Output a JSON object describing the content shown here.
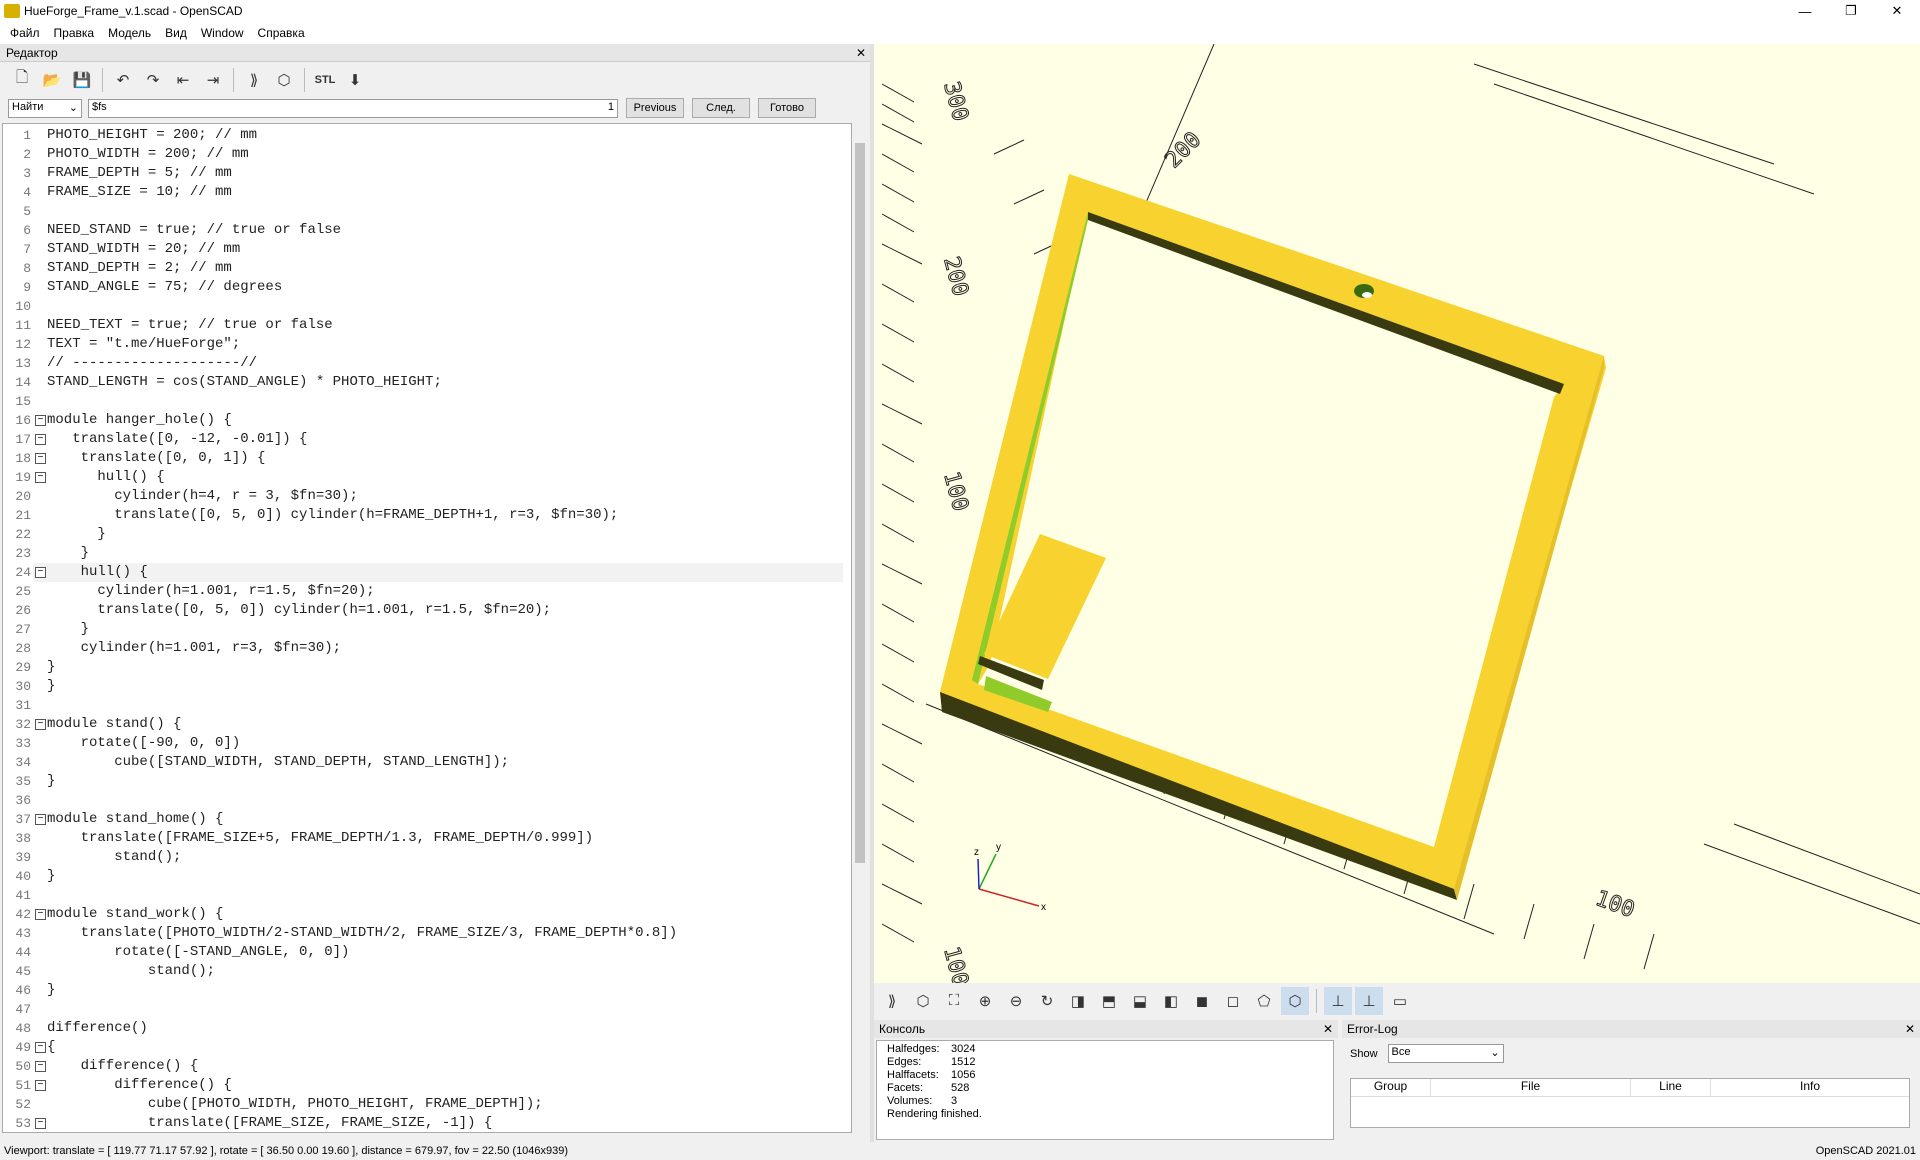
{
  "window": {
    "title": "HueForge_Frame_v.1.scad - OpenSCAD",
    "minimize": "—",
    "maximize": "❐",
    "close": "✕"
  },
  "menu": [
    "Файл",
    "Правка",
    "Модель",
    "Вид",
    "Window",
    "Справка"
  ],
  "editor": {
    "title": "Редактор",
    "close": "✕"
  },
  "find": {
    "mode": "Найти",
    "query": "$fs",
    "count": "1",
    "previous": "Previous",
    "next": "След.",
    "done": "Готово"
  },
  "code": [
    {
      "n": "1",
      "t": "PHOTO_HEIGHT = 200; // mm"
    },
    {
      "n": "2",
      "t": "PHOTO_WIDTH = 200; // mm"
    },
    {
      "n": "3",
      "t": "FRAME_DEPTH = 5; // mm"
    },
    {
      "n": "4",
      "t": "FRAME_SIZE = 10; // mm"
    },
    {
      "n": "5",
      "t": ""
    },
    {
      "n": "6",
      "t": "NEED_STAND = true; // true or false"
    },
    {
      "n": "7",
      "t": "STAND_WIDTH = 20; // mm"
    },
    {
      "n": "8",
      "t": "STAND_DEPTH = 2; // mm"
    },
    {
      "n": "9",
      "t": "STAND_ANGLE = 75; // degrees"
    },
    {
      "n": "10",
      "t": ""
    },
    {
      "n": "11",
      "t": "NEED_TEXT = true; // true or false"
    },
    {
      "n": "12",
      "t": "TEXT = \"t.me/HueForge\";"
    },
    {
      "n": "13",
      "t": "// --------------------//"
    },
    {
      "n": "14",
      "t": "STAND_LENGTH = cos(STAND_ANGLE) * PHOTO_HEIGHT;"
    },
    {
      "n": "15",
      "t": ""
    },
    {
      "n": "16",
      "t": "module hanger_hole() {"
    },
    {
      "n": "17",
      "t": "   translate([0, -12, -0.01]) {"
    },
    {
      "n": "18",
      "t": "    translate([0, 0, 1]) {"
    },
    {
      "n": "19",
      "t": "      hull() {"
    },
    {
      "n": "20",
      "t": "        cylinder(h=4, r = 3, $fn=30);"
    },
    {
      "n": "21",
      "t": "        translate([0, 5, 0]) cylinder(h=FRAME_DEPTH+1, r=3, $fn=30);"
    },
    {
      "n": "22",
      "t": "      }"
    },
    {
      "n": "23",
      "t": "    }"
    },
    {
      "n": "24",
      "t": "    hull() {"
    },
    {
      "n": "25",
      "t": "      cylinder(h=1.001, r=1.5, $fn=20);"
    },
    {
      "n": "26",
      "t": "      translate([0, 5, 0]) cylinder(h=1.001, r=1.5, $fn=20);"
    },
    {
      "n": "27",
      "t": "    }"
    },
    {
      "n": "28",
      "t": "    cylinder(h=1.001, r=3, $fn=30);"
    },
    {
      "n": "29",
      "t": "}"
    },
    {
      "n": "30",
      "t": "}"
    },
    {
      "n": "31",
      "t": ""
    },
    {
      "n": "32",
      "t": "module stand() {"
    },
    {
      "n": "33",
      "t": "    rotate([-90, 0, 0])"
    },
    {
      "n": "34",
      "t": "        cube([STAND_WIDTH, STAND_DEPTH, STAND_LENGTH]);"
    },
    {
      "n": "35",
      "t": "}"
    },
    {
      "n": "36",
      "t": ""
    },
    {
      "n": "37",
      "t": "module stand_home() {"
    },
    {
      "n": "38",
      "t": "    translate([FRAME_SIZE+5, FRAME_DEPTH/1.3, FRAME_DEPTH/0.999])"
    },
    {
      "n": "39",
      "t": "        stand();"
    },
    {
      "n": "40",
      "t": "}"
    },
    {
      "n": "41",
      "t": ""
    },
    {
      "n": "42",
      "t": "module stand_work() {"
    },
    {
      "n": "43",
      "t": "    translate([PHOTO_WIDTH/2-STAND_WIDTH/2, FRAME_SIZE/3, FRAME_DEPTH*0.8])"
    },
    {
      "n": "44",
      "t": "        rotate([-STAND_ANGLE, 0, 0])"
    },
    {
      "n": "45",
      "t": "            stand();"
    },
    {
      "n": "46",
      "t": "}"
    },
    {
      "n": "47",
      "t": ""
    },
    {
      "n": "48",
      "t": "difference()"
    },
    {
      "n": "49",
      "t": "{"
    },
    {
      "n": "50",
      "t": "    difference() {"
    },
    {
      "n": "51",
      "t": "        difference() {"
    },
    {
      "n": "52",
      "t": "            cube([PHOTO_WIDTH, PHOTO_HEIGHT, FRAME_DEPTH]);"
    },
    {
      "n": "53",
      "t": "            translate([FRAME_SIZE, FRAME_SIZE, -1]) {"
    }
  ],
  "axes": {
    "x": "x",
    "y": "y",
    "z": "z"
  },
  "console": {
    "title": "Консоль",
    "close": "✕",
    "stats": [
      {
        "label": "Halfedges:",
        "value": "3024"
      },
      {
        "label": "Edges:",
        "value": "1512"
      },
      {
        "label": "Halffacets:",
        "value": "1056"
      },
      {
        "label": "Facets:",
        "value": "528"
      },
      {
        "label": "Volumes:",
        "value": "3"
      }
    ],
    "status": "Rendering finished."
  },
  "errlog": {
    "title": "Error-Log",
    "close": "✕",
    "show_label": "Show",
    "show_value": "Все",
    "columns": [
      "Group",
      "File",
      "Line",
      "Info"
    ]
  },
  "statusbar": {
    "viewport": "Viewport: translate = [ 119.77 71.17 57.92 ], rotate = [ 36.50 0.00 19.60 ], distance = 679.97, fov = 22.50 (1046x939)",
    "version": "OpenSCAD 2021.01"
  },
  "colors": {
    "model": "#f8d22e",
    "model_shade": "#3a3a10",
    "viewport_bg": "#ffffe6",
    "green_face": "#8fcc2a"
  }
}
